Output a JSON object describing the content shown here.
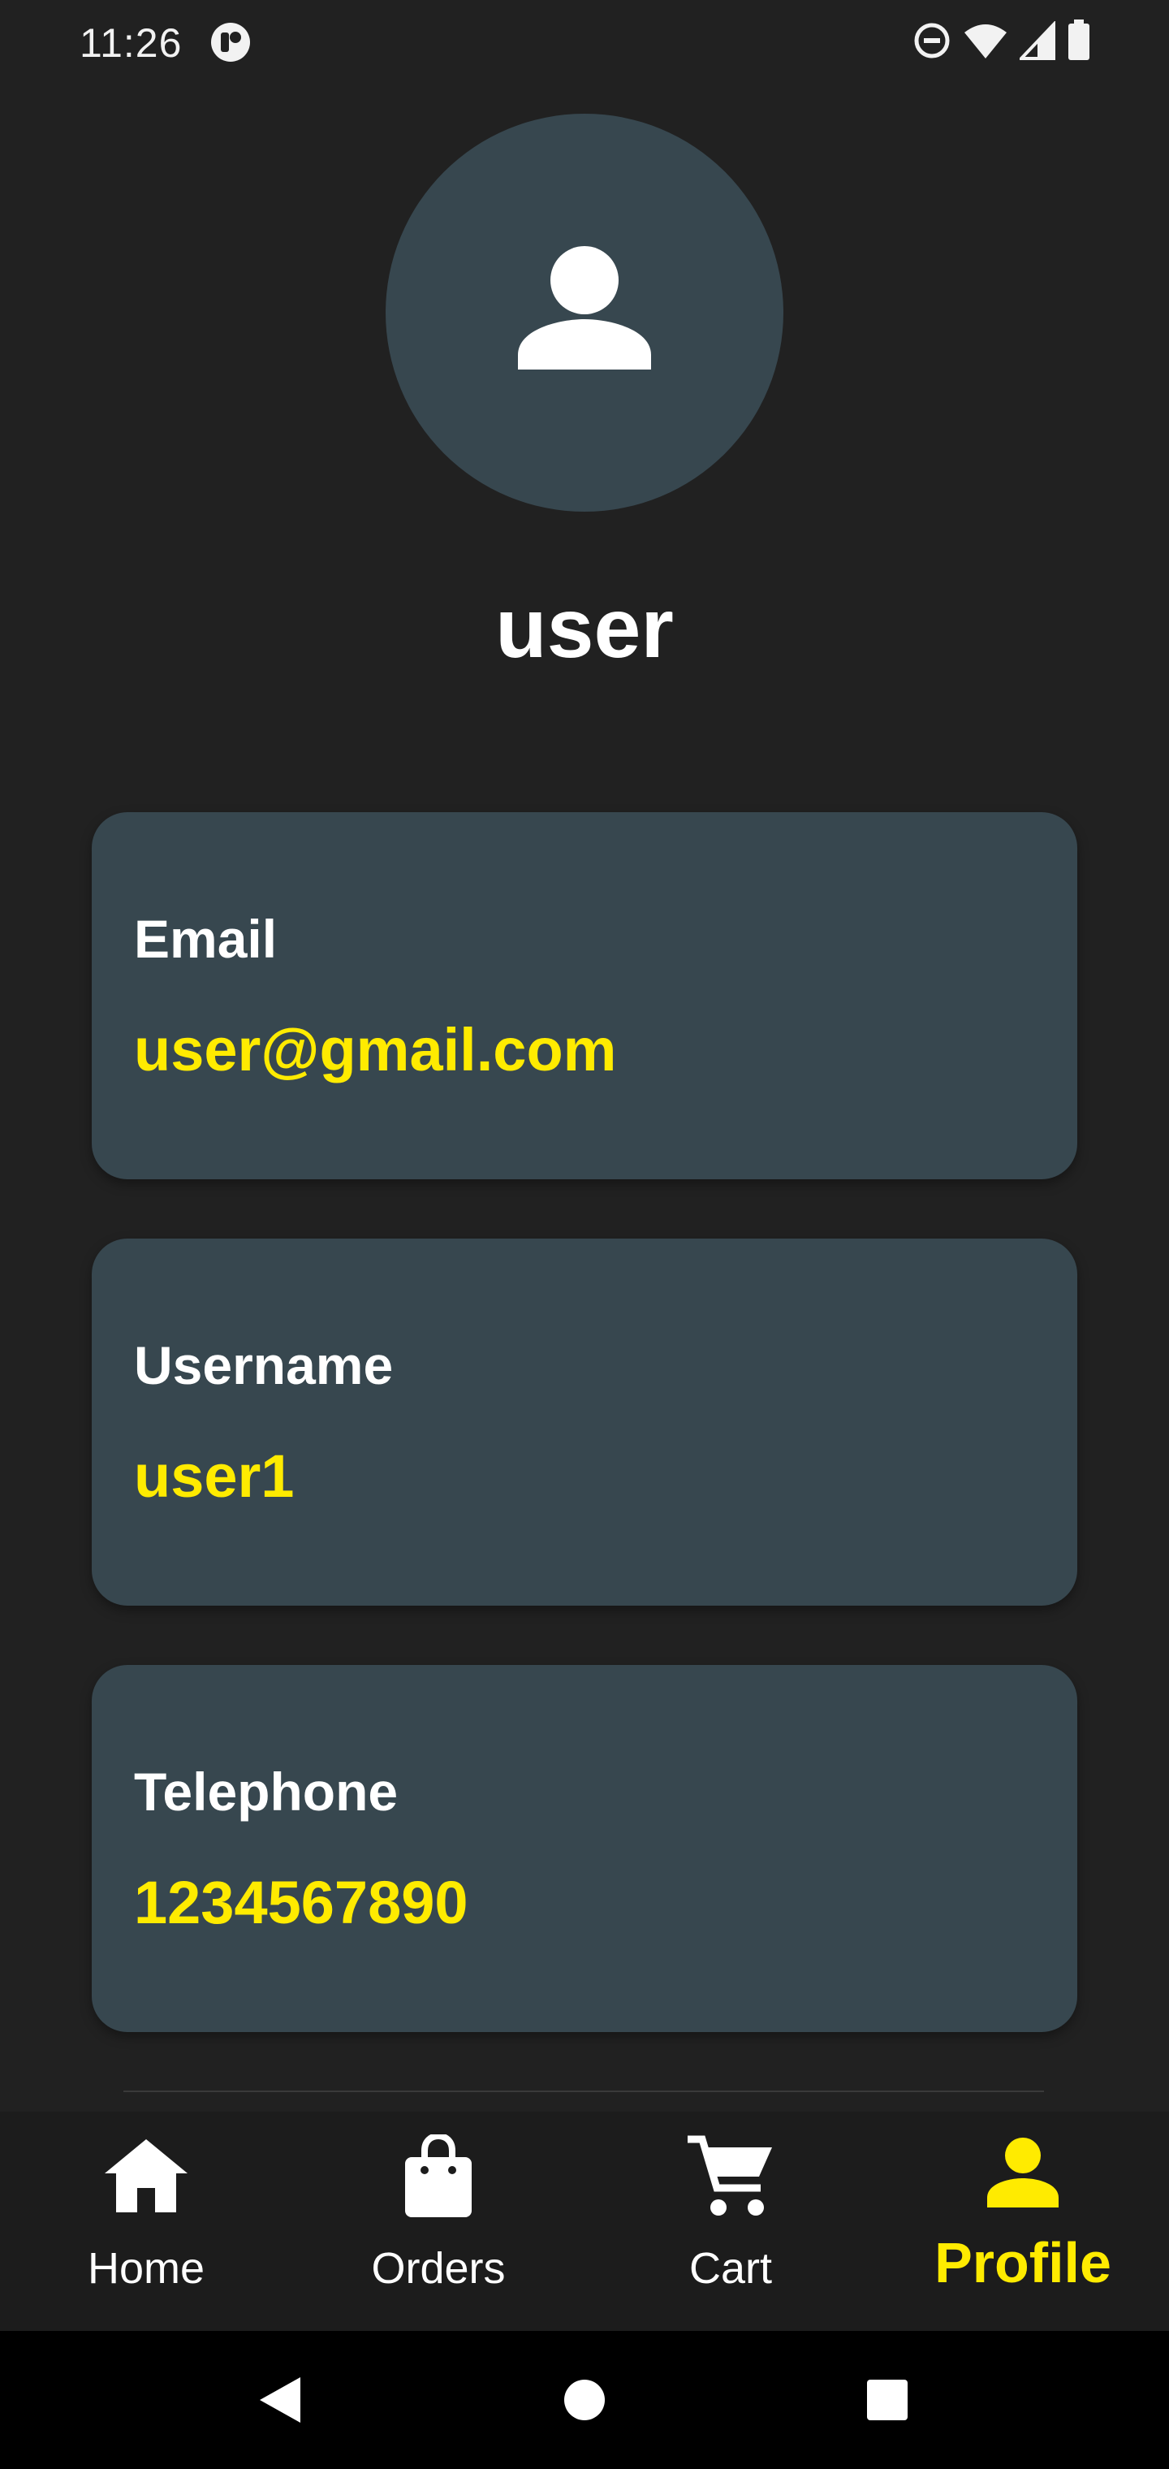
{
  "status_bar": {
    "time": "11:26",
    "icons": [
      "app-notification-icon",
      "do-not-disturb-icon",
      "wifi-icon",
      "signal-icon",
      "battery-icon"
    ]
  },
  "profile": {
    "avatar_icon": "person-icon",
    "display_name": "user"
  },
  "cards": [
    {
      "label": "Email",
      "value": "user@gmail.com"
    },
    {
      "label": "Username",
      "value": "user1"
    },
    {
      "label": "Telephone",
      "value": "1234567890"
    }
  ],
  "bottom_nav": {
    "items": [
      {
        "label": "Home",
        "icon": "home-icon",
        "active": false
      },
      {
        "label": "Orders",
        "icon": "shopping-bag-icon",
        "active": false
      },
      {
        "label": "Cart",
        "icon": "cart-icon",
        "active": false
      },
      {
        "label": "Profile",
        "icon": "person-icon",
        "active": true
      }
    ]
  },
  "system_nav": {
    "buttons": [
      "back-icon",
      "home-circle-icon",
      "recents-icon"
    ]
  },
  "colors": {
    "background": "#212121",
    "card": "#37474f",
    "accent": "#ffeb00",
    "text": "#ffffff"
  }
}
